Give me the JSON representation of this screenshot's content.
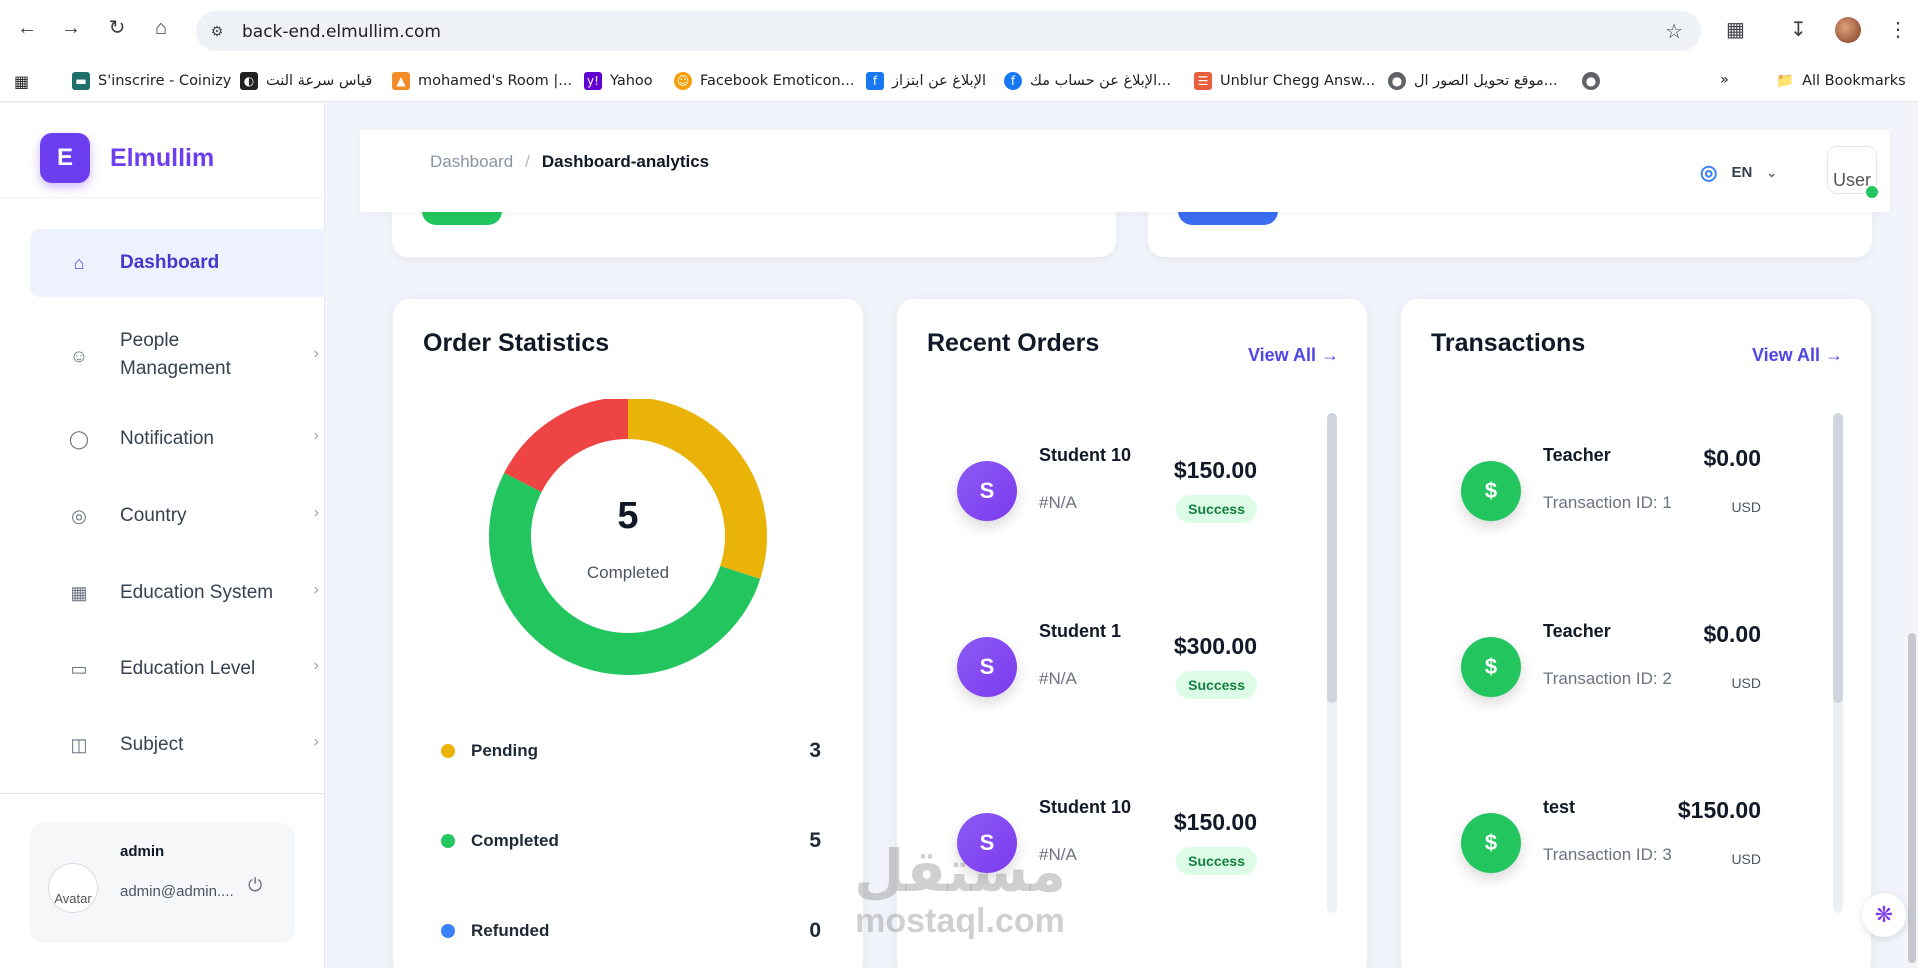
{
  "browser": {
    "url": "back-end.elmullim.com",
    "bookmarks": [
      {
        "label": "S'inscrire - Coinizy",
        "color": "#1f6f6a",
        "icon": "card-icon"
      },
      {
        "label": "قياس سرعة النت",
        "color": "#222222",
        "icon": "speed-icon"
      },
      {
        "label": "mohamed's Room |...",
        "color": "#f28c28",
        "icon": "room-icon"
      },
      {
        "label": "Yahoo",
        "color": "#6001d2",
        "icon": "yahoo-icon"
      },
      {
        "label": "Facebook Emoticon...",
        "color": "#f59e0b",
        "icon": "emoticon-icon"
      },
      {
        "label": "الإبلاغ عن ابتزاز",
        "color": "#1877f2",
        "icon": "facebook-icon"
      },
      {
        "label": "الإبلاغ عن حساب مك...",
        "color": "#1877f2",
        "icon": "facebook-icon"
      },
      {
        "label": "Unblur Chegg Answ...",
        "color": "#e85d3a",
        "icon": "books-icon"
      },
      {
        "label": "موقع تحويل الصور ال...",
        "color": "#5f6368",
        "icon": "globe-icon"
      }
    ],
    "all_bookmarks": "All Bookmarks"
  },
  "sidebar": {
    "brand_letter": "E",
    "brand_name": "Elmullim",
    "items": [
      {
        "label": "Dashboard",
        "icon": "home-icon",
        "active": true
      },
      {
        "label": "People\nManagement",
        "icon": "people-icon",
        "active": false
      },
      {
        "label": "Notification",
        "icon": "user-icon",
        "active": false
      },
      {
        "label": "Country",
        "icon": "globe-icon",
        "active": false
      },
      {
        "label": "Education System",
        "icon": "building-icon",
        "active": false
      },
      {
        "label": "Education Level",
        "icon": "book-icon",
        "active": false
      },
      {
        "label": "Subject",
        "icon": "columns-icon",
        "active": false
      }
    ],
    "user": {
      "name": "admin",
      "email": "admin@admin....",
      "avatar_alt": "Avatar"
    }
  },
  "topbar": {
    "breadcrumb": [
      "Dashboard",
      "Dashboard-analytics"
    ],
    "language": "EN",
    "user_alt": "User"
  },
  "order_statistics": {
    "title": "Order Statistics",
    "center_value": "5",
    "center_label": "Completed",
    "legend": [
      {
        "label": "Pending",
        "value": "3",
        "color": "#eab308"
      },
      {
        "label": "Completed",
        "value": "5",
        "color": "#22c55e"
      },
      {
        "label": "Refunded",
        "value": "0",
        "color": "#3b82f6"
      }
    ]
  },
  "chart_data": {
    "type": "pie",
    "categories": [
      "Pending",
      "Completed",
      "Refunded"
    ],
    "values": [
      3,
      5,
      0
    ],
    "colors": [
      "#eab308",
      "#22c55e",
      "#ef4444"
    ],
    "title": "Order Statistics"
  },
  "recent_orders": {
    "title": "Recent Orders",
    "view_all": "View All →",
    "items": [
      {
        "initial": "S",
        "name": "Student 10",
        "ref": "#N/A",
        "amount": "$150.00",
        "status": "Success"
      },
      {
        "initial": "S",
        "name": "Student 1",
        "ref": "#N/A",
        "amount": "$300.00",
        "status": "Success"
      },
      {
        "initial": "S",
        "name": "Student 10",
        "ref": "#N/A",
        "amount": "$150.00",
        "status": "Success"
      }
    ]
  },
  "transactions": {
    "title": "Transactions",
    "view_all": "View All →",
    "items": [
      {
        "icon": "$",
        "name": "Teacher",
        "tx": "Transaction ID: 1",
        "amount": "$0.00",
        "currency": "USD"
      },
      {
        "icon": "$",
        "name": "Teacher",
        "tx": "Transaction ID: 2",
        "amount": "$0.00",
        "currency": "USD"
      },
      {
        "icon": "$",
        "name": "test",
        "tx": "Transaction ID: 3",
        "amount": "$150.00",
        "currency": "USD"
      }
    ]
  },
  "watermark": {
    "arabic": "مستقل",
    "latin": "mostaql.com"
  }
}
